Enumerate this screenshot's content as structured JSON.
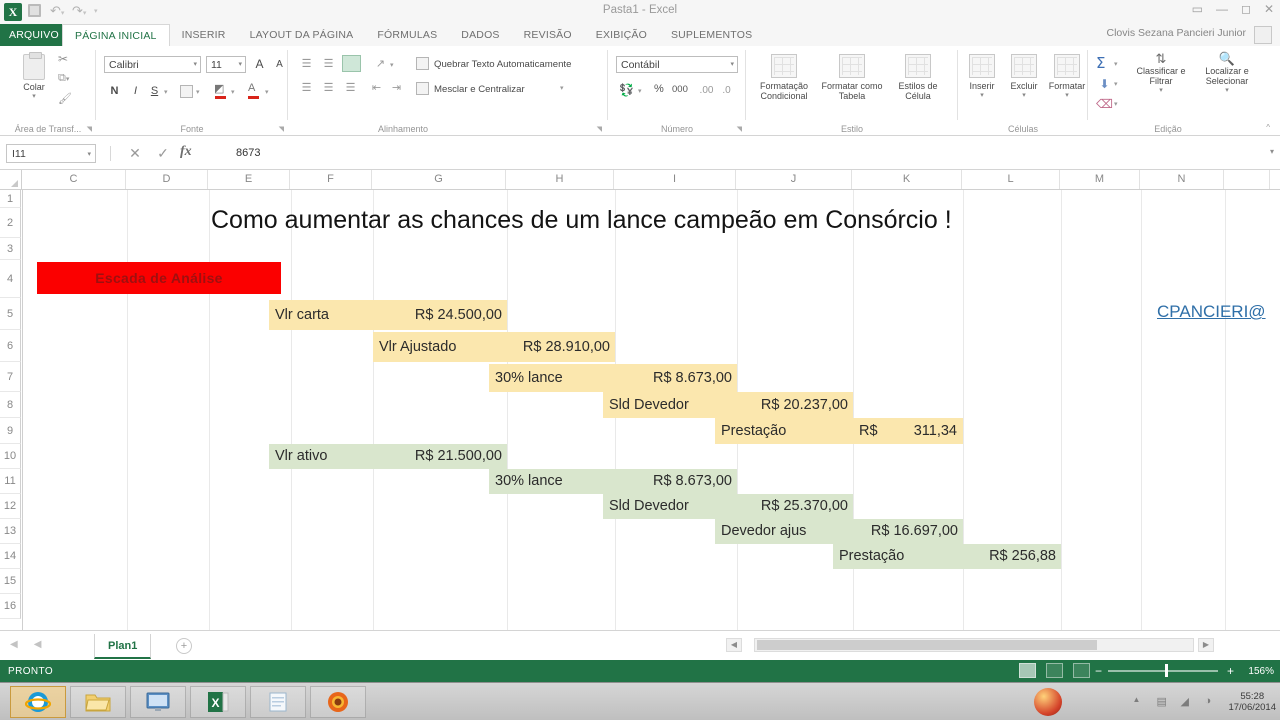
{
  "window": {
    "doc_title": "Pasta1 - Excel",
    "controls": {
      "help": "?",
      "ribbon_options": "▭",
      "minimize": "—",
      "restore": "◻",
      "close": "✕"
    }
  },
  "quick_access": {
    "logo": "excel-logo-icon",
    "items": [
      "save-icon",
      "undo-icon",
      "redo-icon",
      "touch-mode-icon"
    ]
  },
  "ribbon": {
    "file_tab": "ARQUIVO",
    "tabs": [
      {
        "label": "PÁGINA INICIAL",
        "active": true
      },
      {
        "label": "INSERIR",
        "active": false
      },
      {
        "label": "LAYOUT DA PÁGINA",
        "active": false
      },
      {
        "label": "FÓRMULAS",
        "active": false
      },
      {
        "label": "DADOS",
        "active": false
      },
      {
        "label": "REVISÃO",
        "active": false
      },
      {
        "label": "EXIBIÇÃO",
        "active": false
      },
      {
        "label": "SUPLEMENTOS",
        "active": false
      }
    ],
    "user_account": "Clovis Sezana Pancieri Junior",
    "groups": {
      "clipboard": {
        "label": "Área de Transf...",
        "paste": "Colar",
        "cut": "cut-scissors-icon",
        "copy": "copy-icon",
        "format_painter": "format-painter-icon"
      },
      "font": {
        "label": "Fonte",
        "font_name": "Calibri",
        "font_size": "11",
        "grow": "A",
        "shrink": "A",
        "bold": "N",
        "italic": "I",
        "underline": "S",
        "borders": "borders-icon",
        "fill_color": "fill-color-icon",
        "font_color": "font-color-icon"
      },
      "alignment": {
        "label": "Alinhamento",
        "wrap_text": "Quebrar Texto Automaticamente",
        "merge_center": "Mesclar e Centralizar",
        "orientation": "orientation-icon"
      },
      "number": {
        "label": "Número",
        "format": "Contábil",
        "currency": "currency-icon",
        "percent": "%",
        "comma": "000",
        "increase_decimal": "increase-decimal-icon",
        "decrease_decimal": "decrease-decimal-icon"
      },
      "styles": {
        "label": "Estilo",
        "conditional": "Formatação Condicional",
        "as_table": "Formatar como Tabela",
        "cell_styles": "Estilos de Célula"
      },
      "cells": {
        "label": "Células",
        "insert": "Inserir",
        "delete": "Excluir",
        "format": "Formatar"
      },
      "editing": {
        "label": "Edição",
        "autosum": "Σ",
        "fill": "fill-down-icon",
        "clear": "clear-icon",
        "sort_filter": "Classificar e Filtrar",
        "find_select": "Localizar e Selecionar"
      }
    }
  },
  "formula_bar": {
    "name_box": "I11",
    "cancel": "✕",
    "enter": "✓",
    "insert_function": "fx",
    "content": "8673",
    "expand": "▾"
  },
  "grid": {
    "columns": [
      "C",
      "D",
      "E",
      "F",
      "G",
      "H",
      "I",
      "J",
      "K",
      "L",
      "M",
      "N"
    ],
    "rows": [
      "1",
      "2",
      "3",
      "4",
      "5",
      "6",
      "7",
      "8",
      "9",
      "10",
      "11",
      "12",
      "13",
      "14",
      "15",
      "16"
    ],
    "title": "Como aumentar as chances de um lance campeão em Consórcio  !",
    "banner": "Escada de Análise",
    "hyperlink": "CPANCIERI@",
    "scenario_yellow": [
      {
        "label": "Vlr carta",
        "value": "R$ 24.500,00",
        "currency": "",
        "amount": ""
      },
      {
        "label": "Vlr Ajustado",
        "value": "R$ 28.910,00",
        "currency": "",
        "amount": ""
      },
      {
        "label": "30% lance",
        "value": "R$ 8.673,00",
        "currency": "",
        "amount": ""
      },
      {
        "label": "Sld Devedor",
        "value": "R$ 20.237,00",
        "currency": "",
        "amount": ""
      },
      {
        "label": "Prestação",
        "value": "",
        "currency": "R$",
        "amount": "311,34"
      }
    ],
    "scenario_green": [
      {
        "label": "Vlr ativo",
        "value": "R$ 21.500,00"
      },
      {
        "label": "30% lance",
        "value": "R$ 8.673,00"
      },
      {
        "label": "Sld Devedor",
        "value": "R$ 25.370,00"
      },
      {
        "label": "Devedor ajus",
        "value": "R$ 16.697,00"
      },
      {
        "label": "Prestação",
        "value": "R$ 256,88"
      }
    ],
    "colors": {
      "yellow": "#fbe7ae",
      "green": "#d9e6cd",
      "banner_bg": "#fb0000",
      "banner_text": "#9e1010",
      "hyperlink": "#2f6fa8"
    }
  },
  "sheet_tabs": {
    "first": "◀",
    "prev": "◀",
    "next": "▶",
    "last": "▶",
    "tabs": [
      {
        "label": "Plan1",
        "active": true
      }
    ],
    "add_sheet": "+"
  },
  "status_bar": {
    "status": "PRONTO",
    "views": [
      "normal-view-icon",
      "page-layout-view-icon",
      "page-break-view-icon"
    ],
    "zoom_out": "−",
    "zoom_in": "+",
    "zoom_level": "156%"
  },
  "taskbar": {
    "items": [
      "internet-explorer-icon",
      "file-explorer-icon",
      "monitor-icon",
      "excel-icon",
      "notepad-icon",
      "firefox-icon"
    ],
    "tray": [
      "show-hidden-icon",
      "network-icon",
      "volume-icon",
      "action-center-icon"
    ],
    "clock_time": "55:28",
    "clock_date": "17/06/2014"
  }
}
